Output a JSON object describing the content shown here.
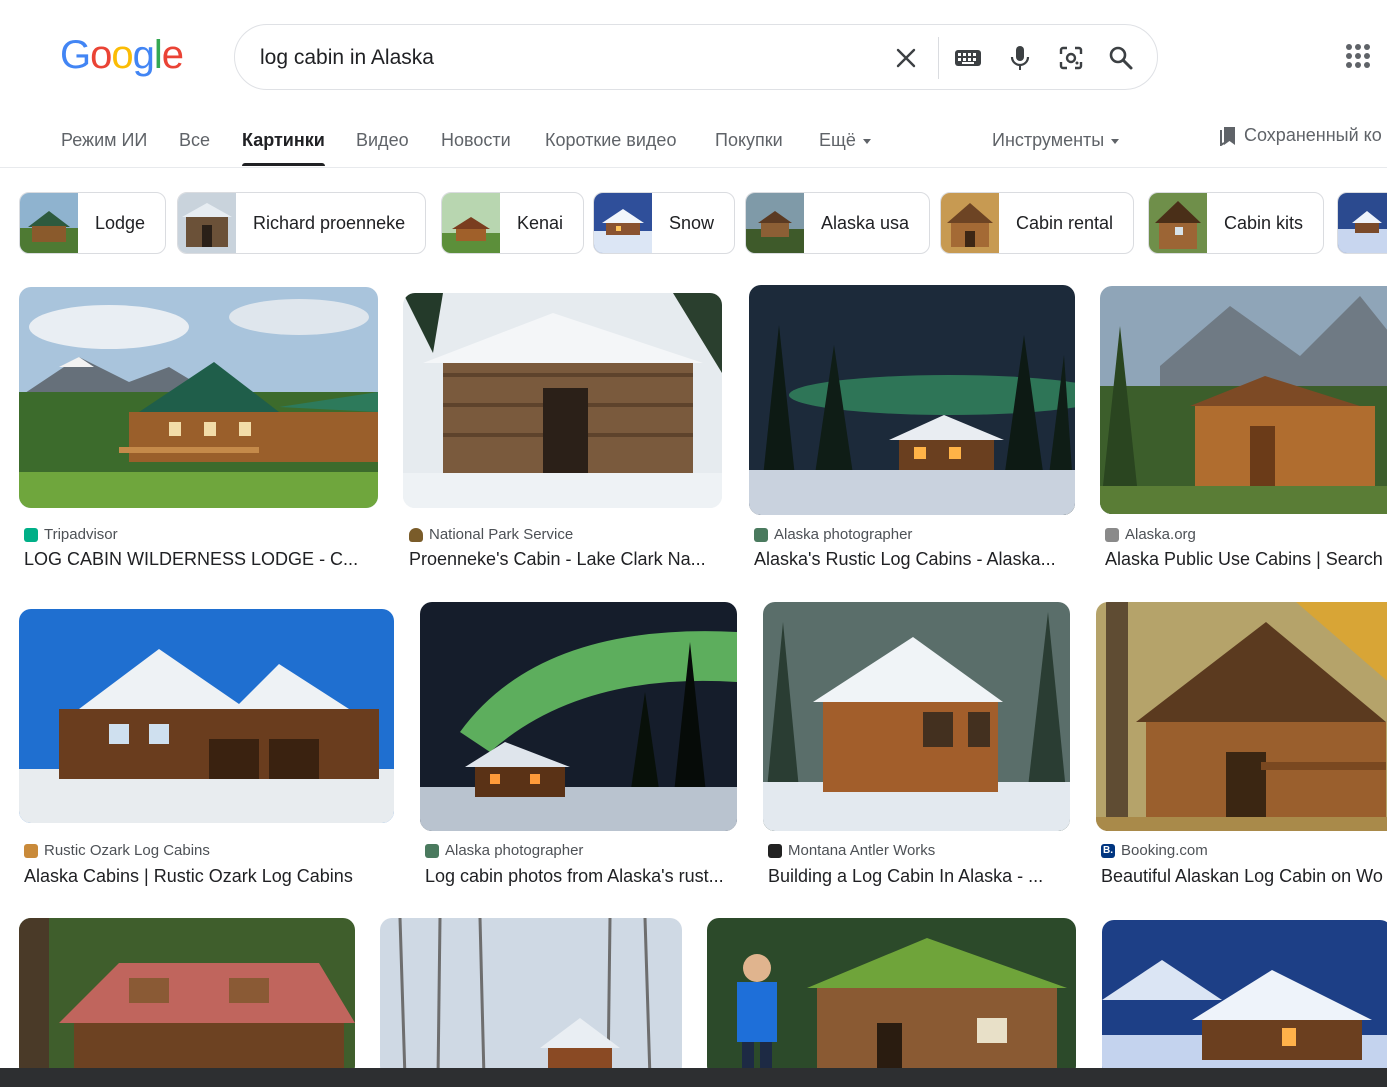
{
  "header": {
    "logo": "Google",
    "search_query": "log cabin in Alaska"
  },
  "tabs": [
    {
      "label": "Режим ИИ"
    },
    {
      "label": "Все"
    },
    {
      "label": "Картинки",
      "active": true
    },
    {
      "label": "Видео"
    },
    {
      "label": "Новости"
    },
    {
      "label": "Короткие видео"
    },
    {
      "label": "Покупки"
    },
    {
      "label": "Ещё"
    },
    {
      "label": "Инструменты"
    },
    {
      "label": "Сохраненный ко"
    }
  ],
  "chips": [
    {
      "label": "Lodge"
    },
    {
      "label": "Richard proenneke"
    },
    {
      "label": "Kenai"
    },
    {
      "label": "Snow"
    },
    {
      "label": "Alaska usa"
    },
    {
      "label": "Cabin rental"
    },
    {
      "label": "Cabin kits"
    }
  ],
  "results": [
    {
      "source": "Tripadvisor",
      "title": "LOG CABIN WILDERNESS LODGE - C..."
    },
    {
      "source": "National Park Service",
      "title": "Proenneke's Cabin - Lake Clark Na..."
    },
    {
      "source": "Alaska photographer",
      "title": "Alaska's Rustic Log Cabins - Alaska..."
    },
    {
      "source": "Alaska.org",
      "title": "Alaska Public Use Cabins | Search"
    },
    {
      "source": "Rustic Ozark Log Cabins",
      "title": "Alaska Cabins | Rustic Ozark Log Cabins"
    },
    {
      "source": "Alaska photographer",
      "title": "Log cabin photos from Alaska's rust..."
    },
    {
      "source": "Montana Antler Works",
      "title": "Building a Log Cabin In Alaska - ..."
    },
    {
      "source": "Booking.com",
      "title": "Beautiful Alaskan Log Cabin on Wo"
    }
  ],
  "colors": {
    "google_blue": "#4285f4",
    "google_red": "#ea4335",
    "google_yellow": "#fbbc05",
    "google_green": "#34a853"
  },
  "icons": [
    "clear-icon",
    "keyboard-icon",
    "mic-icon",
    "lens-icon",
    "search-icon",
    "apps-icon",
    "bookmark-icon"
  ]
}
